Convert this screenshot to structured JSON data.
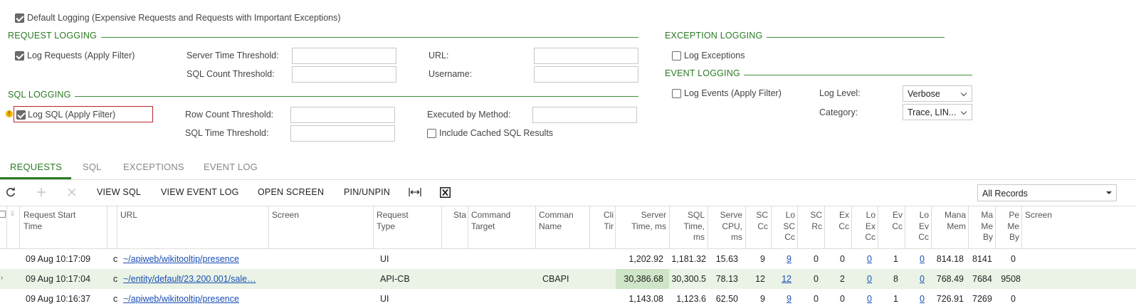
{
  "default_logging": {
    "label": "Default Logging (Expensive Requests and Requests with Important Exceptions)",
    "checked": true
  },
  "request_logging": {
    "title": "REQUEST LOGGING",
    "log_requests": {
      "label": "Log Requests (Apply Filter)",
      "checked": true
    },
    "server_time_threshold_label": "Server Time Threshold:",
    "sql_count_threshold_label": "SQL Count Threshold:",
    "url_label": "URL:",
    "username_label": "Username:"
  },
  "sql_logging": {
    "title": "SQL LOGGING",
    "log_sql": {
      "label": "Log SQL (Apply Filter)",
      "checked": true
    },
    "row_count_threshold_label": "Row Count Threshold:",
    "sql_time_threshold_label": "SQL Time Threshold:",
    "executed_by_method_label": "Executed by Method:",
    "include_cached": {
      "label": "Include Cached SQL Results",
      "checked": false
    }
  },
  "exception_logging": {
    "title": "EXCEPTION LOGGING",
    "log_exceptions": {
      "label": "Log Exceptions",
      "checked": false
    }
  },
  "event_logging": {
    "title": "EVENT LOGGING",
    "log_events": {
      "label": "Log Events (Apply Filter)",
      "checked": false
    },
    "log_level_label": "Log Level:",
    "log_level_value": "Verbose",
    "category_label": "Category:",
    "category_value": "Trace, LIN..."
  },
  "tabs": [
    "REQUESTS",
    "SQL",
    "EXCEPTIONS",
    "EVENT LOG"
  ],
  "toolbar": {
    "view_sql": "VIEW SQL",
    "view_event_log": "VIEW EVENT LOG",
    "open_screen": "OPEN SCREEN",
    "pin_unpin": "PIN/UNPIN",
    "filter_value": "All Records"
  },
  "grid": {
    "headers": {
      "request_start_time": [
        "Request Start",
        "Time"
      ],
      "url": [
        "URL"
      ],
      "screen": [
        "Screen"
      ],
      "request_type": [
        "Request",
        "Type"
      ],
      "status": [
        "Sta"
      ],
      "command_target": [
        "Command",
        "Target"
      ],
      "command_name": [
        "Comman",
        "Name"
      ],
      "client_time": [
        "Cli",
        "Tir"
      ],
      "server_time": [
        "Server",
        "Time, ms"
      ],
      "sql_time": [
        "SQL",
        "Time,",
        "ms"
      ],
      "server_cpu": [
        "Serve",
        "CPU,",
        "ms"
      ],
      "sql_count": [
        "SC",
        "Cc"
      ],
      "logged_sql": [
        "Lo",
        "SC",
        "Cc"
      ],
      "sql_rows": [
        "SC",
        "Rc"
      ],
      "exceptions": [
        "Ex",
        "Cc"
      ],
      "logged_exceptions": [
        "Lo",
        "Ex",
        "Cc"
      ],
      "events": [
        "Ev",
        "Cc"
      ],
      "logged_events": [
        "Lo",
        "Ev",
        "Cc"
      ],
      "managed_memory": [
        "Mana",
        "Mem"
      ],
      "memory_bytes": [
        "Ma",
        "Me",
        "By"
      ],
      "peak_memory": [
        "Pe",
        "Me",
        "By"
      ],
      "screen2": [
        "Screen"
      ]
    },
    "rows": [
      {
        "time": "09 Aug 10:17:09",
        "c": "c",
        "url": "~/apiweb/wikitooltip/presence",
        "type": "UI",
        "name": "",
        "server_time": "1,202.92",
        "sql_time": "1,181.32",
        "cpu": "15.63",
        "sql_count": "9",
        "logged_sql": "9",
        "sql_rows": "0",
        "exc": "0",
        "logged_exc": "0",
        "ev": "1",
        "logged_ev": "0",
        "mem": "814.18",
        "mem_bytes": "8141",
        "peak": "0"
      },
      {
        "time": "09 Aug 10:17:04",
        "c": "c",
        "url": "~/entity/default/23.200.001/sale…",
        "type": "API-CB",
        "name": "CBAPI",
        "server_time": "30,386.68",
        "sql_time": "30,300.5",
        "cpu": "78.13",
        "sql_count": "12",
        "logged_sql": "12",
        "sql_rows": "0",
        "exc": "2",
        "logged_exc": "0",
        "ev": "8",
        "logged_ev": "0",
        "mem": "768.49",
        "mem_bytes": "7684",
        "peak": "9508"
      },
      {
        "time": "09 Aug 10:16:37",
        "c": "c",
        "url": "~/apiweb/wikitooltip/presence",
        "type": "UI",
        "name": "",
        "server_time": "1,143.08",
        "sql_time": "1,123.6",
        "cpu": "62.50",
        "sql_count": "9",
        "logged_sql": "9",
        "sql_rows": "0",
        "exc": "0",
        "logged_exc": "0",
        "ev": "1",
        "logged_ev": "0",
        "mem": "726.91",
        "mem_bytes": "7269",
        "peak": "0"
      }
    ]
  },
  "colors": {
    "accent": "#2b7a24",
    "link": "#1a4fb5",
    "highlight_row": "#eaf3e6",
    "warning": "#f0b400",
    "error_border": "#b52a2a"
  }
}
